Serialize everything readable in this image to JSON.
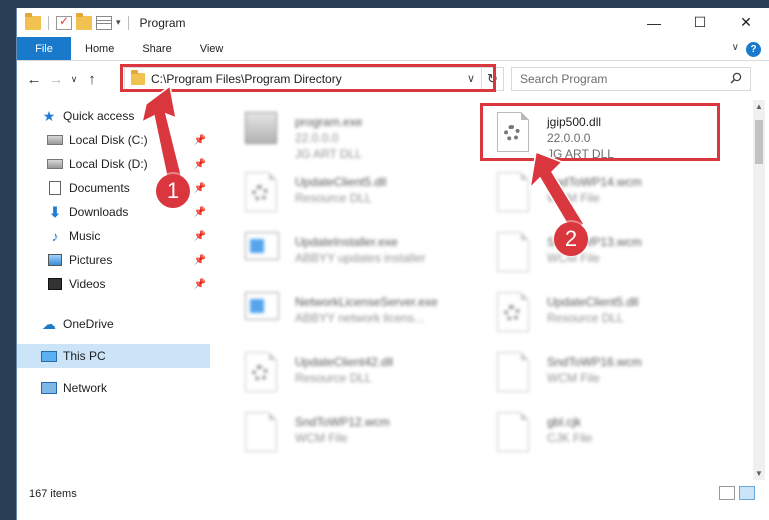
{
  "window": {
    "title": "Program",
    "controls": [
      "—",
      "☐",
      "✕"
    ]
  },
  "ribbon": {
    "tabs": [
      "File",
      "Home",
      "Share",
      "View"
    ],
    "help": "?"
  },
  "address": {
    "path": "C:\\Program Files\\Program Directory",
    "search_placeholder": "Search Program"
  },
  "sidebar": {
    "items": [
      {
        "label": "Quick access",
        "icon": "star-icon"
      },
      {
        "label": "Local Disk (C:)",
        "icon": "disk-icon",
        "pinned": true
      },
      {
        "label": "Local Disk (D:)",
        "icon": "disk-icon",
        "pinned": true
      },
      {
        "label": "Documents",
        "icon": "documents-icon",
        "pinned": true
      },
      {
        "label": "Downloads",
        "icon": "download-icon",
        "pinned": true
      },
      {
        "label": "Music",
        "icon": "music-icon",
        "pinned": true
      },
      {
        "label": "Pictures",
        "icon": "pictures-icon",
        "pinned": true
      },
      {
        "label": "Videos",
        "icon": "videos-icon",
        "pinned": true
      },
      {
        "label": "OneDrive",
        "icon": "cloud-icon"
      },
      {
        "label": "This PC",
        "icon": "computer-icon",
        "selected": true
      },
      {
        "label": "Network",
        "icon": "network-icon"
      }
    ]
  },
  "files": [
    {
      "name": "program.exe",
      "line2": "22.0.0.0",
      "line3": "JG ART DLL",
      "icon": "exe-icon"
    },
    {
      "name": "jgip500.dll",
      "line2": "22.0.0.0",
      "line3": "JG ART DLL",
      "icon": "dll-gear-icon",
      "highlighted": true
    },
    {
      "name": "UpdateClient5.dll",
      "line2": "Resource DLL",
      "line3": "",
      "icon": "dll-gear-icon"
    },
    {
      "name": "SndToWP14.wcm",
      "line2": "WCM File",
      "line3": "",
      "icon": "file-icon"
    },
    {
      "name": "UpdateInstaller.exe",
      "line2": "ABBYY updates installer",
      "line3": "",
      "icon": "app-window-icon"
    },
    {
      "name": "SndToWP13.wcm",
      "line2": "WCM File",
      "line3": "",
      "icon": "file-icon"
    },
    {
      "name": "NetworkLicenseServer.exe",
      "line2": "ABBYY network licens...",
      "line3": "",
      "icon": "app-window-icon"
    },
    {
      "name": "UpdateClient5.dll",
      "line2": "Resource DLL",
      "line3": "",
      "icon": "dll-gear-icon"
    },
    {
      "name": "UpdateClient42.dll",
      "line2": "Resource DLL",
      "line3": "",
      "icon": "dll-gear-icon"
    },
    {
      "name": "SndToWP16.wcm",
      "line2": "WCM File",
      "line3": "",
      "icon": "file-icon"
    },
    {
      "name": "SndToWP12.wcm",
      "line2": "WCM File",
      "line3": "",
      "icon": "file-icon"
    },
    {
      "name": "gbl.cjk",
      "line2": "CJK File",
      "line3": "",
      "icon": "file-icon"
    }
  ],
  "status": {
    "item_count": "167 items"
  },
  "annotations": {
    "badge1": "1",
    "badge2": "2",
    "accent": "#d9363e"
  }
}
